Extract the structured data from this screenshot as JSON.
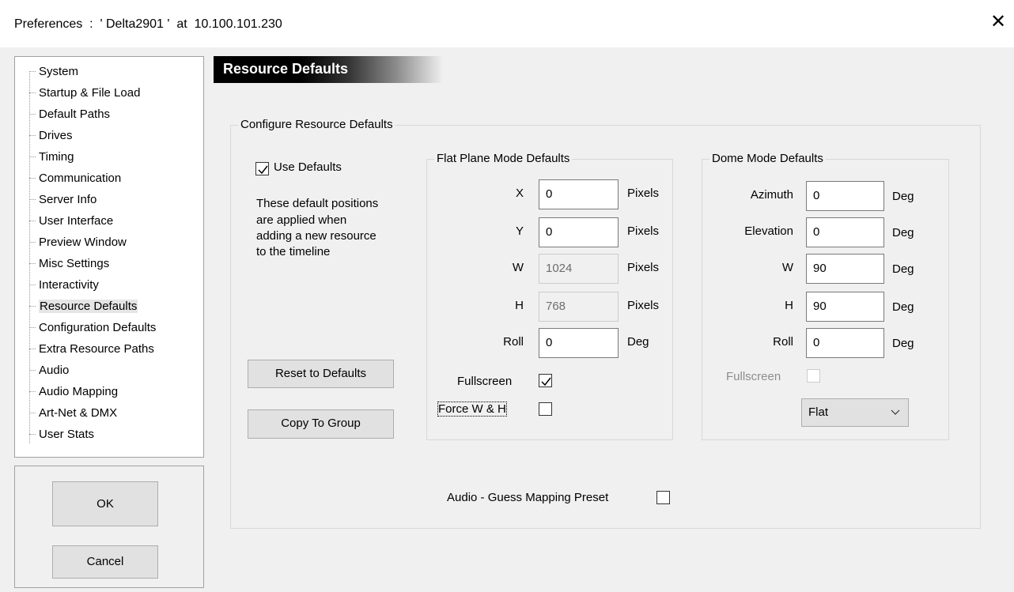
{
  "window": {
    "title": "Preferences  :  ' Delta2901 '  at  10.100.101.230",
    "close_glyph": "✕"
  },
  "tree": {
    "items": [
      "System",
      "Startup & File Load",
      "Default Paths",
      "Drives",
      "Timing",
      "Communication",
      "Server Info",
      "User Interface",
      "Preview Window",
      "Misc Settings",
      "Interactivity",
      "Resource Defaults",
      "Configuration Defaults",
      "Extra Resource Paths",
      "Audio",
      "Audio Mapping",
      "Art-Net & DMX",
      "User Stats"
    ],
    "selected": "Resource Defaults"
  },
  "buttons": {
    "ok": "OK",
    "cancel": "Cancel"
  },
  "header": {
    "title": "Resource Defaults"
  },
  "configure": {
    "group_label": "Configure Resource Defaults",
    "use_defaults_label": "Use Defaults",
    "use_defaults_checked": true,
    "description_lines": [
      "These default positions",
      "are applied when",
      "adding a new resource",
      "to the timeline"
    ],
    "reset_button": "Reset to Defaults",
    "copy_button": "Copy To Group"
  },
  "flat": {
    "group_label": "Flat Plane Mode Defaults",
    "fields": [
      {
        "label": "X",
        "value": "0",
        "unit": "Pixels",
        "disabled": false
      },
      {
        "label": "Y",
        "value": "0",
        "unit": "Pixels",
        "disabled": false
      },
      {
        "label": "W",
        "value": "1024",
        "unit": "Pixels",
        "disabled": true
      },
      {
        "label": "H",
        "value": "768",
        "unit": "Pixels",
        "disabled": true
      },
      {
        "label": "Roll",
        "value": "0",
        "unit": "Deg",
        "disabled": false
      }
    ],
    "fullscreen_label": "Fullscreen",
    "fullscreen_checked": true,
    "force_label": "Force W & H",
    "force_checked": false
  },
  "dome": {
    "group_label": "Dome Mode Defaults",
    "fields": [
      {
        "label": "Azimuth",
        "value": "0",
        "unit": "Deg"
      },
      {
        "label": "Elevation",
        "value": "0",
        "unit": "Deg"
      },
      {
        "label": "W",
        "value": "90",
        "unit": "Deg"
      },
      {
        "label": "H",
        "value": "90",
        "unit": "Deg"
      },
      {
        "label": "Roll",
        "value": "0",
        "unit": "Deg"
      }
    ],
    "fullscreen_label": "Fullscreen",
    "fullscreen_checked": false,
    "mode_select": "Flat"
  },
  "audio": {
    "guess_label": "Audio - Guess Mapping Preset",
    "guess_checked": false
  }
}
